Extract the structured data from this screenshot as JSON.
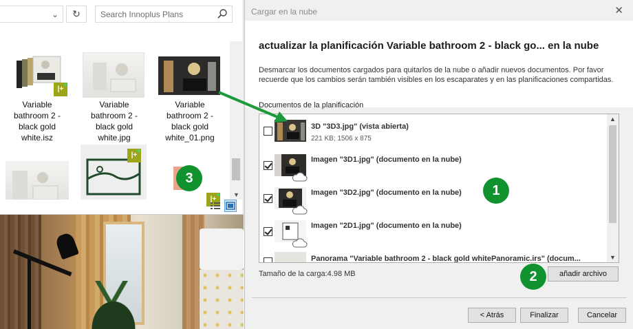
{
  "explorer": {
    "search_placeholder": "Search Innoplus Plans",
    "files": [
      {
        "name": "Variable bathroom 2 - black gold white.isz",
        "lines": [
          "Variable",
          "bathroom 2 -",
          "black gold",
          "white.isz"
        ]
      },
      {
        "name": "Variable bathroom 2 - black gold white.jpg",
        "lines": [
          "Variable",
          "bathroom 2 -",
          "black gold",
          "white.jpg"
        ]
      },
      {
        "name": "Variable bathroom 2 - black gold white_01.png",
        "lines": [
          "Variable",
          "bathroom 2 -",
          "black gold",
          "white_01.png"
        ]
      }
    ],
    "badge_glyph": "|+"
  },
  "dialog": {
    "title": "Cargar en la nube",
    "heading": "actualizar la planificación  Variable bathroom 2 - black go... en la nube",
    "description": "Desmarcar los documentos cargados para quitarlos de la nube o añadir nuevos documentos. Por favor recuerde que los cambios serán también visibles en los escaparates y en las planificaciones compartidas.",
    "section_label": "Documentos de la planificación",
    "documents": [
      {
        "name": "3D \"3D3.jpg\" (vista abierta)",
        "sub": "221 KB; 1506 x 875",
        "checked": false,
        "cloud": false
      },
      {
        "name": "Imagen \"3D1.jpg\" (documento en la nube)",
        "sub": "",
        "checked": true,
        "cloud": true
      },
      {
        "name": "Imagen \"3D2.jpg\" (documento en la nube)",
        "sub": "",
        "checked": true,
        "cloud": true
      },
      {
        "name": "Imagen \"2D1.jpg\" (documento en la nube)",
        "sub": "",
        "checked": true,
        "cloud": true
      },
      {
        "name": "Panorama \"Variable bathroom 2 - black gold whitePanoramic.irs\" (docum...",
        "sub": "",
        "checked": false,
        "cloud": false
      }
    ],
    "upload_size": "Tamaño de la carga:4.98 MB",
    "add_file_button": "añadir archivo",
    "back_button": "< Atrás",
    "finish_button": "Finalizar",
    "cancel_button": "Cancelar",
    "close_glyph": "✕"
  },
  "annotations": {
    "step1": "1",
    "step2": "2",
    "step3": "3"
  },
  "colors": {
    "step_green": "#10932e",
    "arrow_green": "#1c9a3c",
    "badge_olive": "#9da61a"
  }
}
